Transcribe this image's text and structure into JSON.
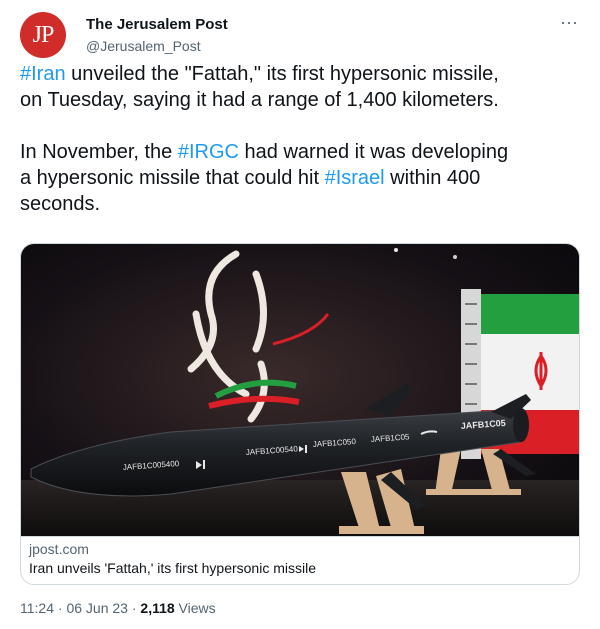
{
  "author": {
    "avatar_initials": "JP",
    "avatar_color": "#d02d2a",
    "name": "The Jerusalem Post",
    "handle": "@Jerusalem_Post"
  },
  "tweet": {
    "p1_tag": "#Iran",
    "p1_text": " unveiled the \"Fattah,\" its first hypersonic missile,\non Tuesday, saying it had a range of 1,400 kilometers.",
    "p2_lead": "In November, the ",
    "p2_tag1": "#IRGC",
    "p2_mid": " had warned it was developing\na hypersonic missile that could hit ",
    "p2_tag2": "#Israel",
    "p2_end": " within 400\nseconds."
  },
  "card": {
    "domain": "jpost.com",
    "title": "Iran unveils 'Fattah,' its first hypersonic missile",
    "image_alt_icon": "missile-photo"
  },
  "footer": {
    "time": "11:24",
    "sep1": " · ",
    "date": "06 Jun 23",
    "sep2": " · ",
    "views_count": "2,118",
    "views_label": " Views"
  },
  "colors": {
    "link": "#1d9bf0",
    "secondary_text": "#536471",
    "border": "#cfd9de"
  }
}
